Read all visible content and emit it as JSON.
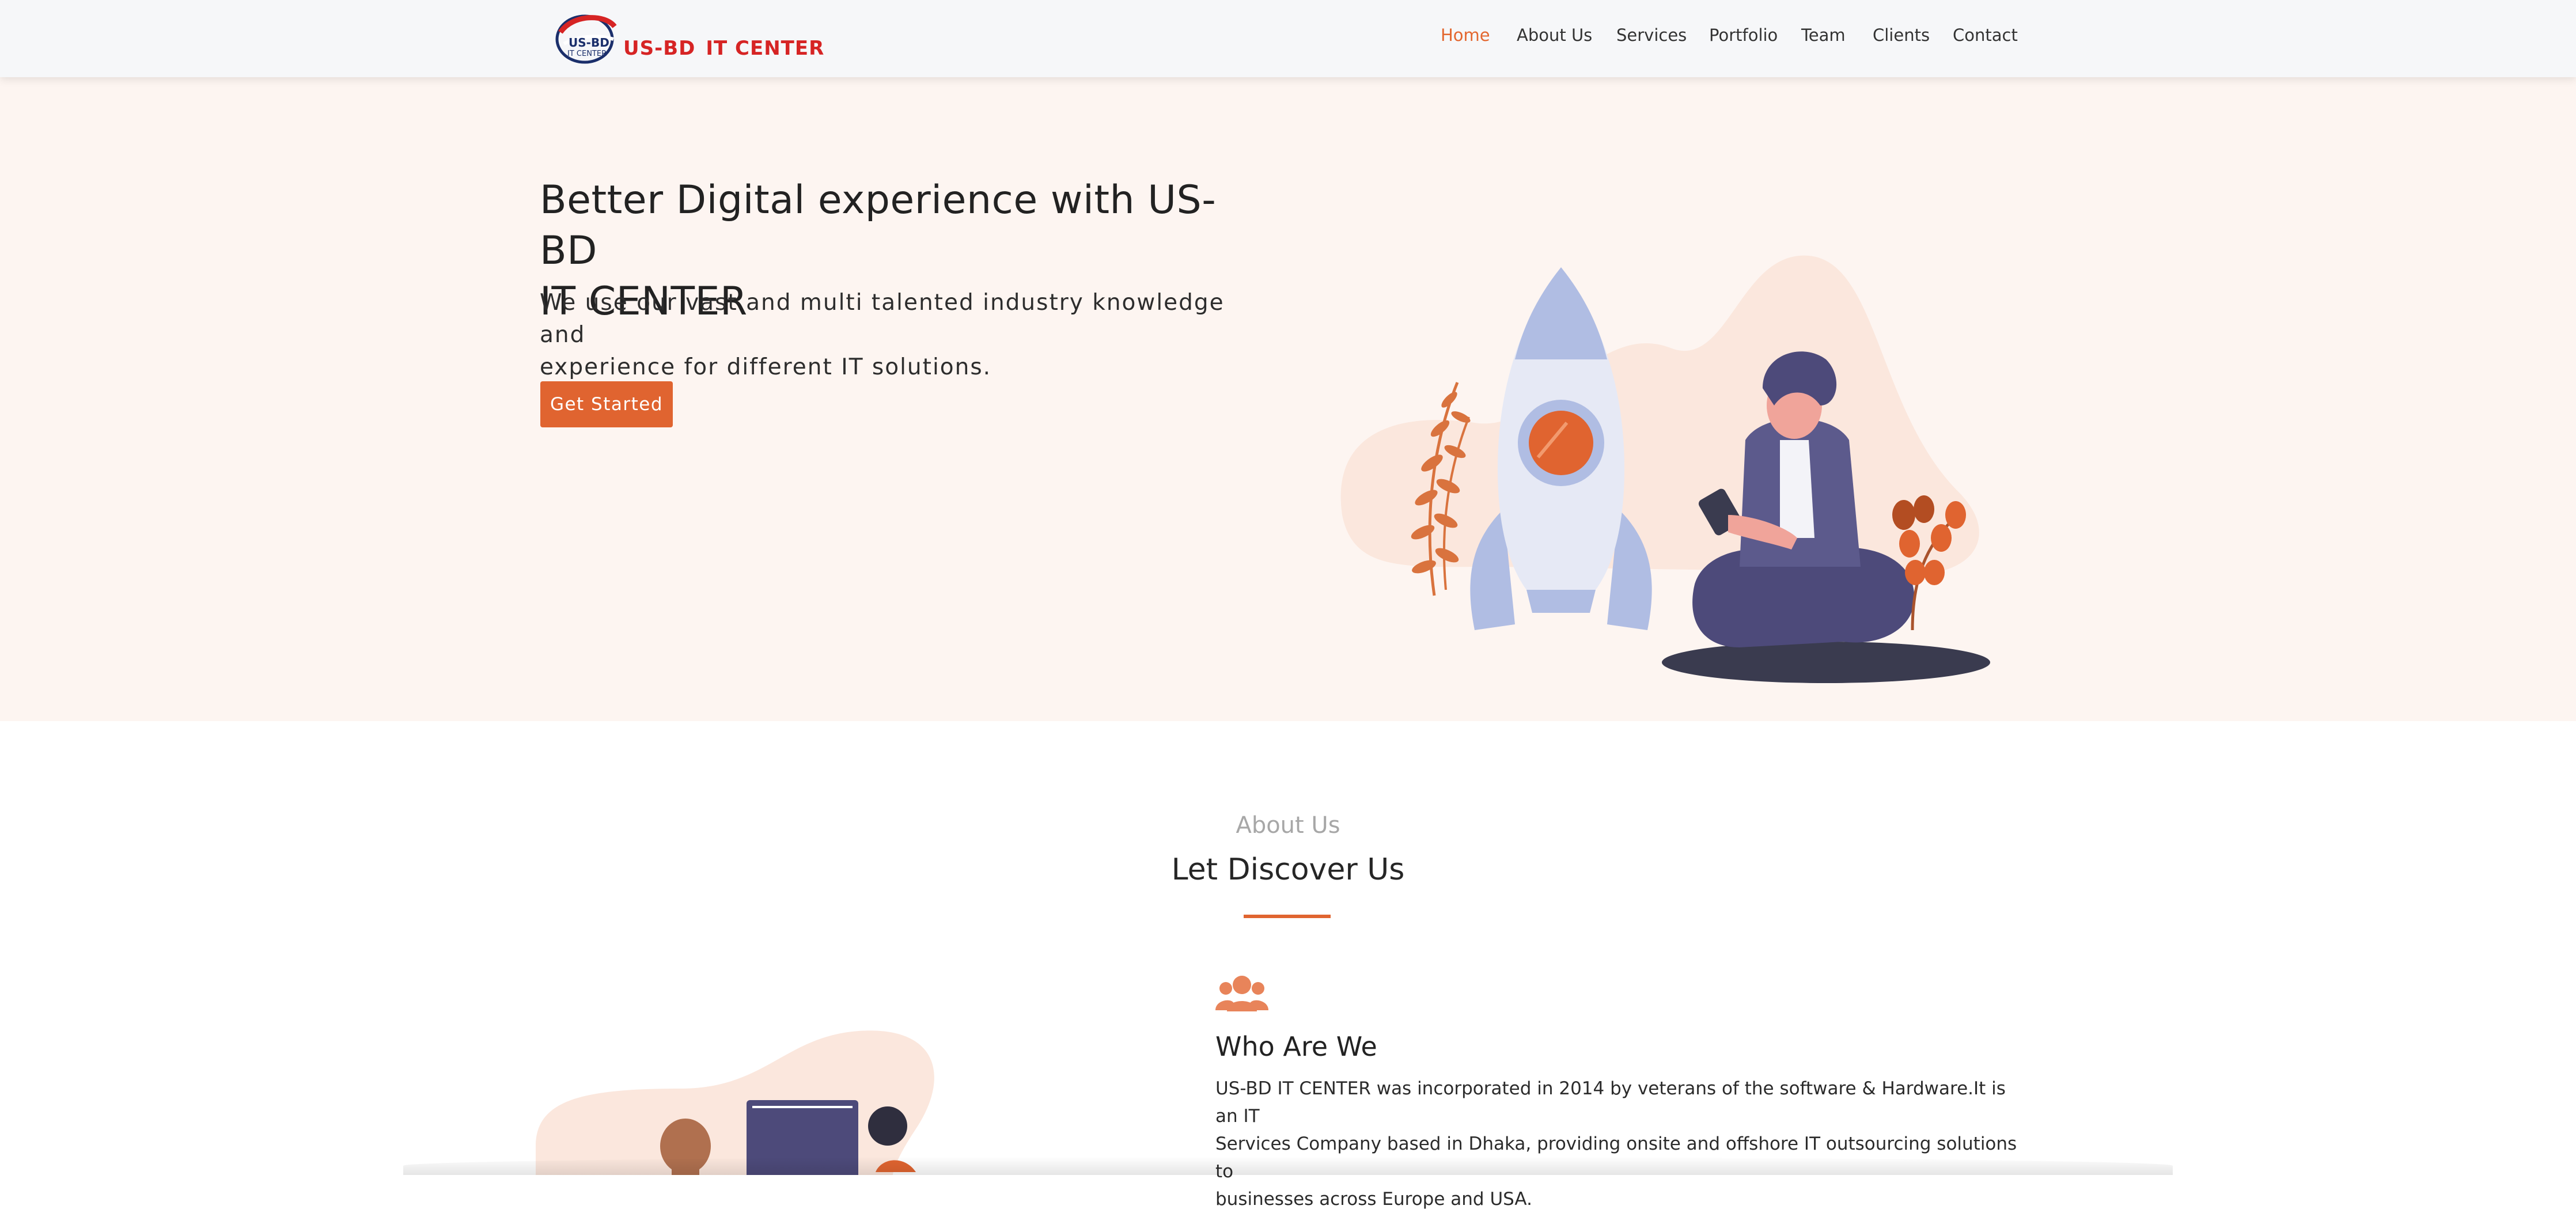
{
  "brand": {
    "logo_mark_line1": "US-BD",
    "logo_mark_line2": "IT CENTER",
    "wordmark_part1": "US-BD",
    "wordmark_part2": "IT CENTER",
    "accent_color": "#e06430",
    "logo_red": "#d62424",
    "logo_navy": "#1b2f6b"
  },
  "nav": {
    "items": [
      {
        "label": "Home",
        "active": true
      },
      {
        "label": "About Us",
        "active": false
      },
      {
        "label": "Services",
        "active": false
      },
      {
        "label": "Portfolio",
        "active": false
      },
      {
        "label": "Team",
        "active": false
      },
      {
        "label": "Clients",
        "active": false
      },
      {
        "label": "Contact",
        "active": false
      }
    ]
  },
  "hero": {
    "title_line1": "Better Digital experience with US-BD",
    "title_line2": "IT CENTER",
    "subtitle_line1": "We use our vast and multi talented industry knowledge and",
    "subtitle_line2": "experience for different IT solutions.",
    "cta_label": "Get Started",
    "illustration": "rocket-and-person-illustration"
  },
  "about": {
    "eyebrow": "About Us",
    "heading": "Let Discover Us",
    "who_icon": "users-icon",
    "who_heading": "Who Are We",
    "who_body_line1": "US-BD IT CENTER was incorporated in 2014 by veterans of the software & Hardware.It is an IT",
    "who_body_line2": "Services Company based in Dhaka, providing onsite and offshore IT outsourcing solutions to",
    "who_body_line3": "businesses across Europe and USA.",
    "illustration": "team-laptop-illustration"
  }
}
